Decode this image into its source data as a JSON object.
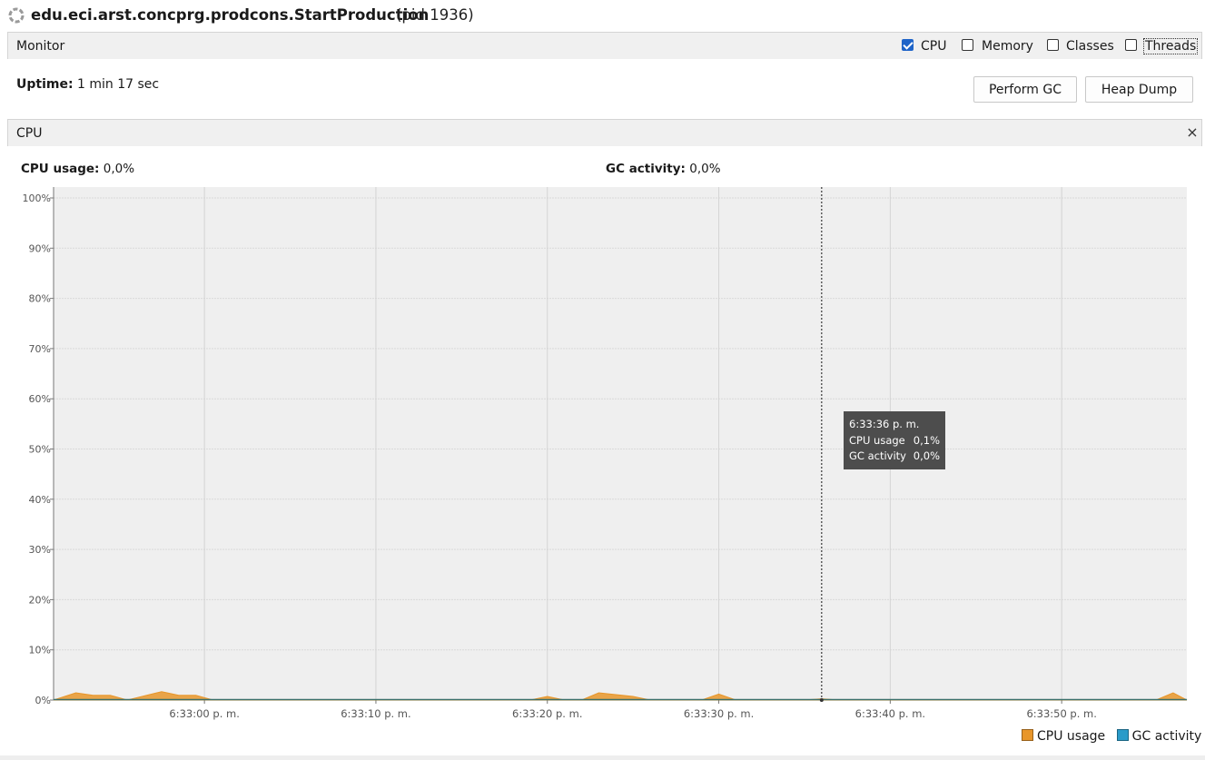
{
  "header": {
    "title": "edu.eci.arst.concprg.prodcons.StartProduction",
    "pid": "(pid 1936)",
    "icon": "spinner-icon"
  },
  "monitor": {
    "label": "Monitor",
    "options": [
      {
        "label": "CPU",
        "checked": true
      },
      {
        "label": "Memory",
        "checked": false
      },
      {
        "label": "Classes",
        "checked": false
      },
      {
        "label": "Threads",
        "checked": false
      }
    ]
  },
  "uptime": {
    "label": "Uptime:",
    "value": "1 min 17 sec"
  },
  "buttons": {
    "perform_gc": "Perform GC",
    "heap_dump": "Heap Dump"
  },
  "cpu_panel": {
    "title": "CPU",
    "close_icon": "×",
    "cpu_usage_label": "CPU usage:",
    "cpu_usage_value": "0,0%",
    "gc_activity_label": "GC activity:",
    "gc_activity_value": "0,0%"
  },
  "tooltip": {
    "time": "6:33:36 p. m.",
    "rows": [
      {
        "label": "CPU usage",
        "value": "0,1%"
      },
      {
        "label": "GC activity",
        "value": "0,0%"
      }
    ]
  },
  "colors": {
    "cpu": "#e8962a",
    "gc": "#2a9bc9",
    "accent": "#1e64c8"
  },
  "chart_data": {
    "type": "area",
    "y_ticks": [
      "100%",
      "90%",
      "80%",
      "70%",
      "60%",
      "50%",
      "40%",
      "30%",
      "20%",
      "10%",
      "0%"
    ],
    "x_ticks": [
      "6:33:00 p. m.",
      "6:33:10 p. m.",
      "6:33:20 p. m.",
      "6:33:30 p. m.",
      "6:33:40 p. m.",
      "6:33:50 p. m."
    ],
    "ylim": [
      0,
      100
    ],
    "x_range_seconds": [
      51.2,
      117.3
    ],
    "x_tick_seconds": [
      60,
      70,
      80,
      90,
      100,
      110
    ],
    "cursor_seconds": 96,
    "grid": true,
    "legend": "bottom-right",
    "series": [
      {
        "name": "CPU usage",
        "x": [
          51.2,
          52.5,
          53.5,
          54.5,
          55.5,
          57.5,
          58.5,
          59.5,
          60.5,
          61.5,
          79,
          80,
          81,
          82,
          83,
          85,
          86,
          87,
          88,
          89,
          90,
          91,
          92,
          95,
          96,
          97,
          115.5,
          116.5,
          117.3
        ],
        "y": [
          0,
          0.6,
          0.4,
          0.4,
          0,
          0.7,
          0.4,
          0.4,
          0,
          0,
          0,
          0.3,
          0,
          0,
          0.6,
          0.3,
          0,
          0,
          0,
          0,
          0.5,
          0,
          0,
          0,
          0.1,
          0,
          0,
          0.6,
          0
        ]
      },
      {
        "name": "GC activity",
        "x": [
          51.2,
          117.3
        ],
        "y": [
          0,
          0
        ]
      }
    ]
  }
}
